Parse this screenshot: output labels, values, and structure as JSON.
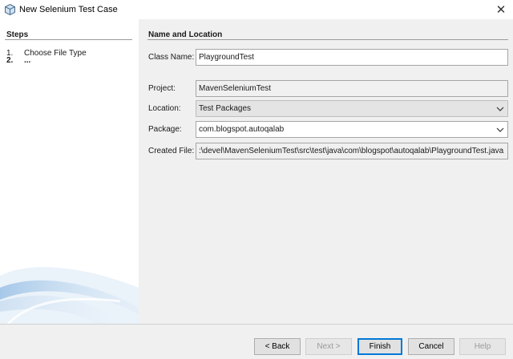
{
  "window": {
    "title": "New Selenium Test Case",
    "close_glyph": "✕"
  },
  "steps": {
    "title": "Steps",
    "items": [
      {
        "num": "1.",
        "label": "Choose File Type"
      },
      {
        "num": "2.",
        "label": "..."
      }
    ]
  },
  "form": {
    "title": "Name and Location",
    "class_name": {
      "label": "Class Name:",
      "value": "PlaygroundTest"
    },
    "project": {
      "label": "Project:",
      "value": "MavenSeleniumTest"
    },
    "location": {
      "label": "Location:",
      "value": "Test Packages"
    },
    "package": {
      "label": "Package:",
      "value": "com.blogspot.autoqalab"
    },
    "created_file": {
      "label": "Created File:",
      "value": ":\\devel\\MavenSeleniumTest\\src\\test\\java\\com\\blogspot\\autoqalab\\PlaygroundTest.java"
    }
  },
  "buttons": {
    "back": "< Back",
    "next": "Next >",
    "finish": "Finish",
    "cancel": "Cancel",
    "help": "Help"
  },
  "colors": {
    "accent": "#0078d7",
    "panel": "#f0f0f0"
  },
  "icons": {
    "app": "netbeans-cube-icon",
    "dropdown": "chevron-down-icon",
    "close": "close-icon"
  }
}
